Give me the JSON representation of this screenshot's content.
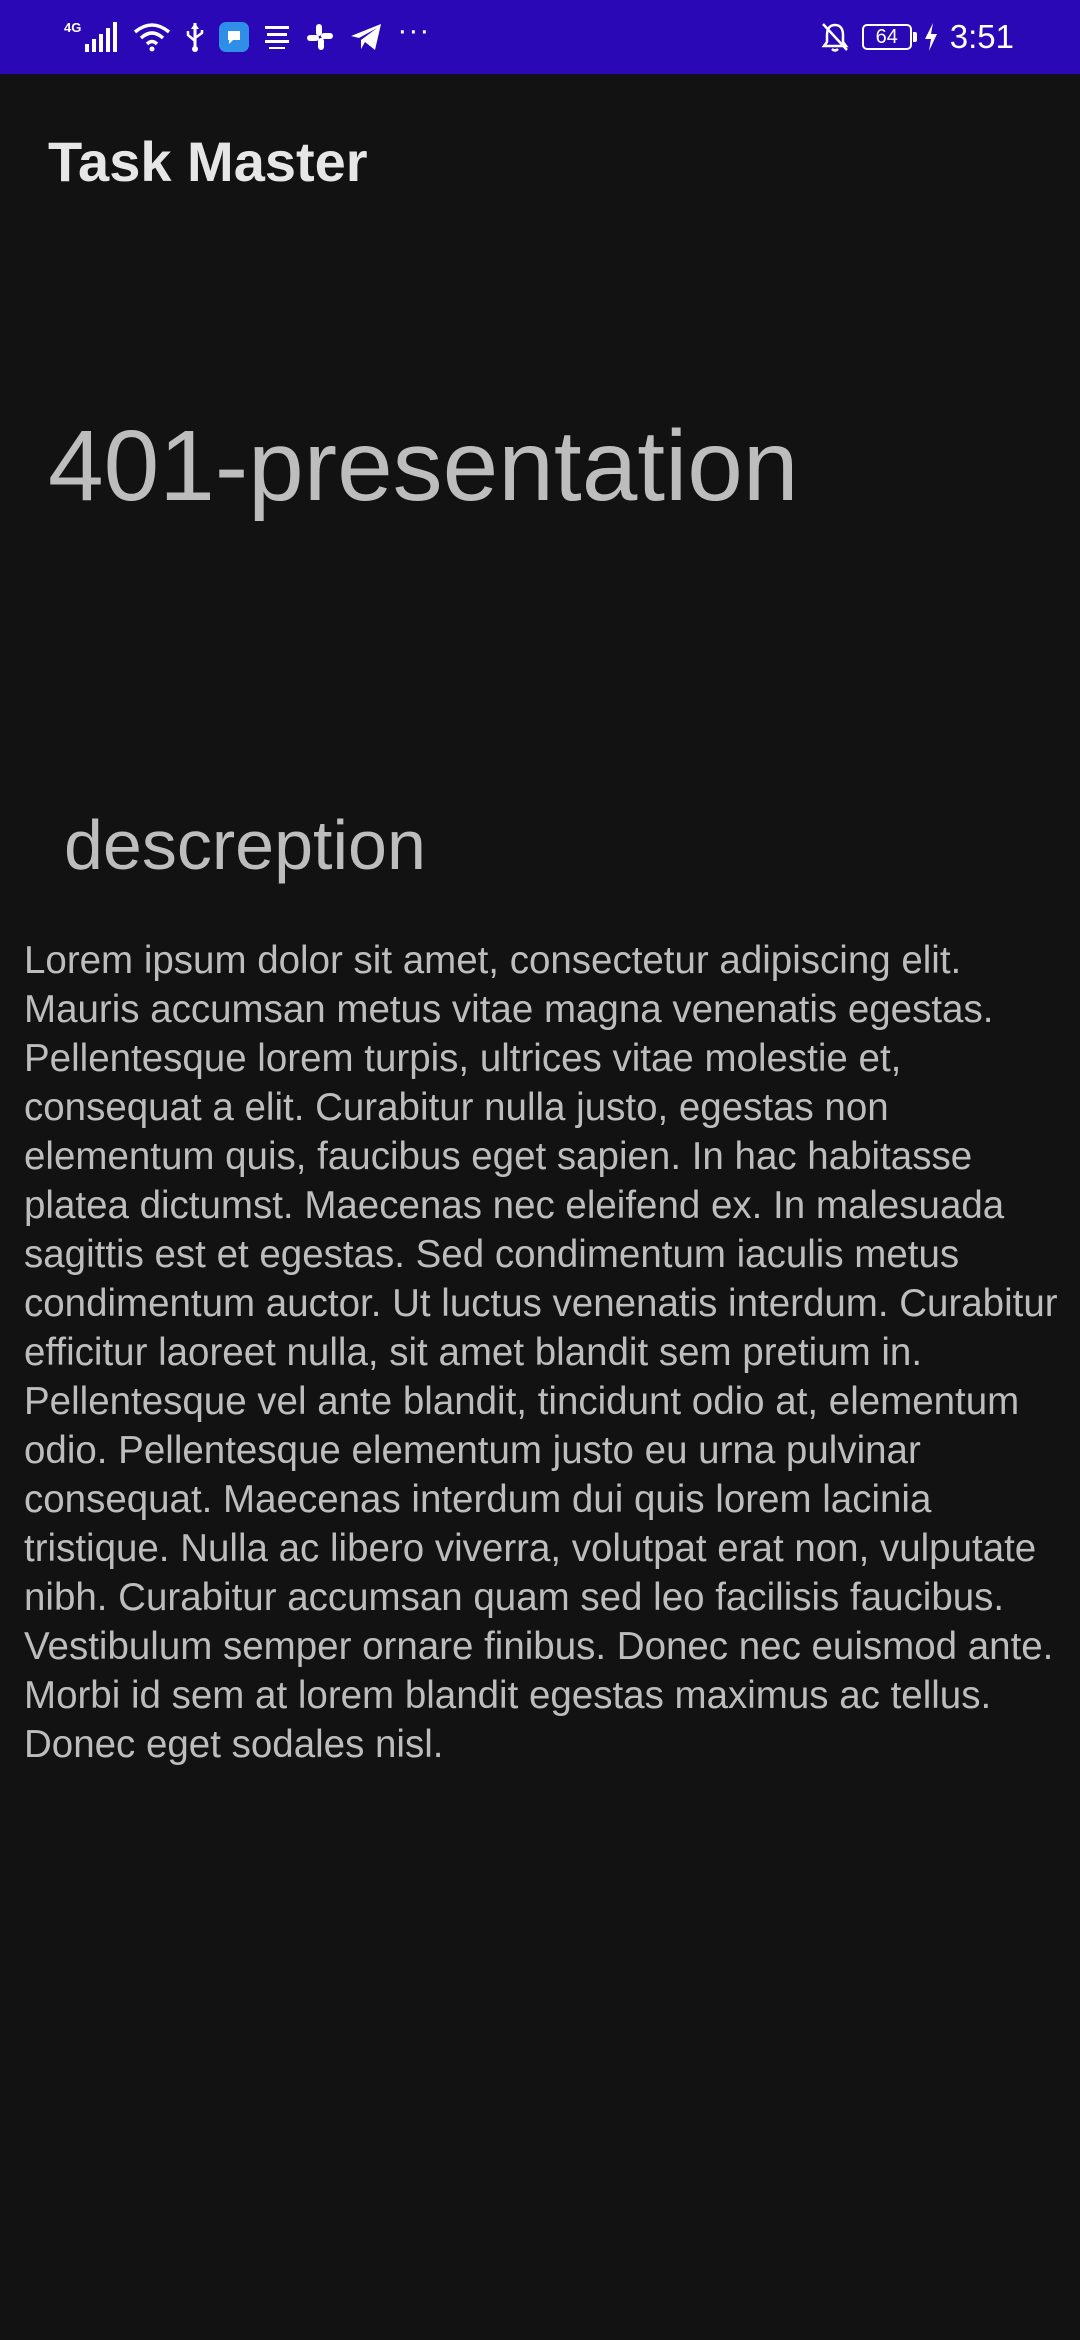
{
  "status_bar": {
    "network_type": "4G",
    "icons": [
      "signal-icon",
      "wifi-icon",
      "usb-icon",
      "app-notification-icon",
      "arabic-app-icon",
      "slack-icon",
      "telegram-icon"
    ],
    "more_indicator": "···",
    "battery_level": "64",
    "time": "3:51",
    "background_color": "#2a08b5"
  },
  "app": {
    "title": "Task Master"
  },
  "task": {
    "title": "401-presentation",
    "description_heading": "descreption",
    "description": "Lorem ipsum dolor sit amet, consectetur adipiscing elit. Mauris accumsan metus vitae magna venenatis egestas. Pellentesque lorem turpis, ultrices vitae molestie et, consequat a elit. Curabitur nulla justo, egestas non elementum quis, faucibus eget sapien. In hac habitasse platea dictumst. Maecenas nec eleifend ex. In malesuada sagittis est et egestas. Sed condimentum iaculis metus condimentum auctor. Ut luctus venenatis interdum. Curabitur efficitur laoreet nulla, sit amet blandit sem pretium in. Pellentesque vel ante blandit, tincidunt odio at, elementum odio. Pellentesque elementum justo eu urna pulvinar consequat. Maecenas interdum dui quis lorem lacinia tristique. Nulla ac libero viverra, volutpat erat non, vulputate nibh. Curabitur accumsan quam sed leo facilisis faucibus. Vestibulum semper ornare finibus. Donec nec euismod ante. Morbi id sem at lorem blandit egestas maximus ac tellus. Donec eget sodales nisl."
  },
  "theme": {
    "background": "#121212",
    "text": "#bdbdbd"
  }
}
